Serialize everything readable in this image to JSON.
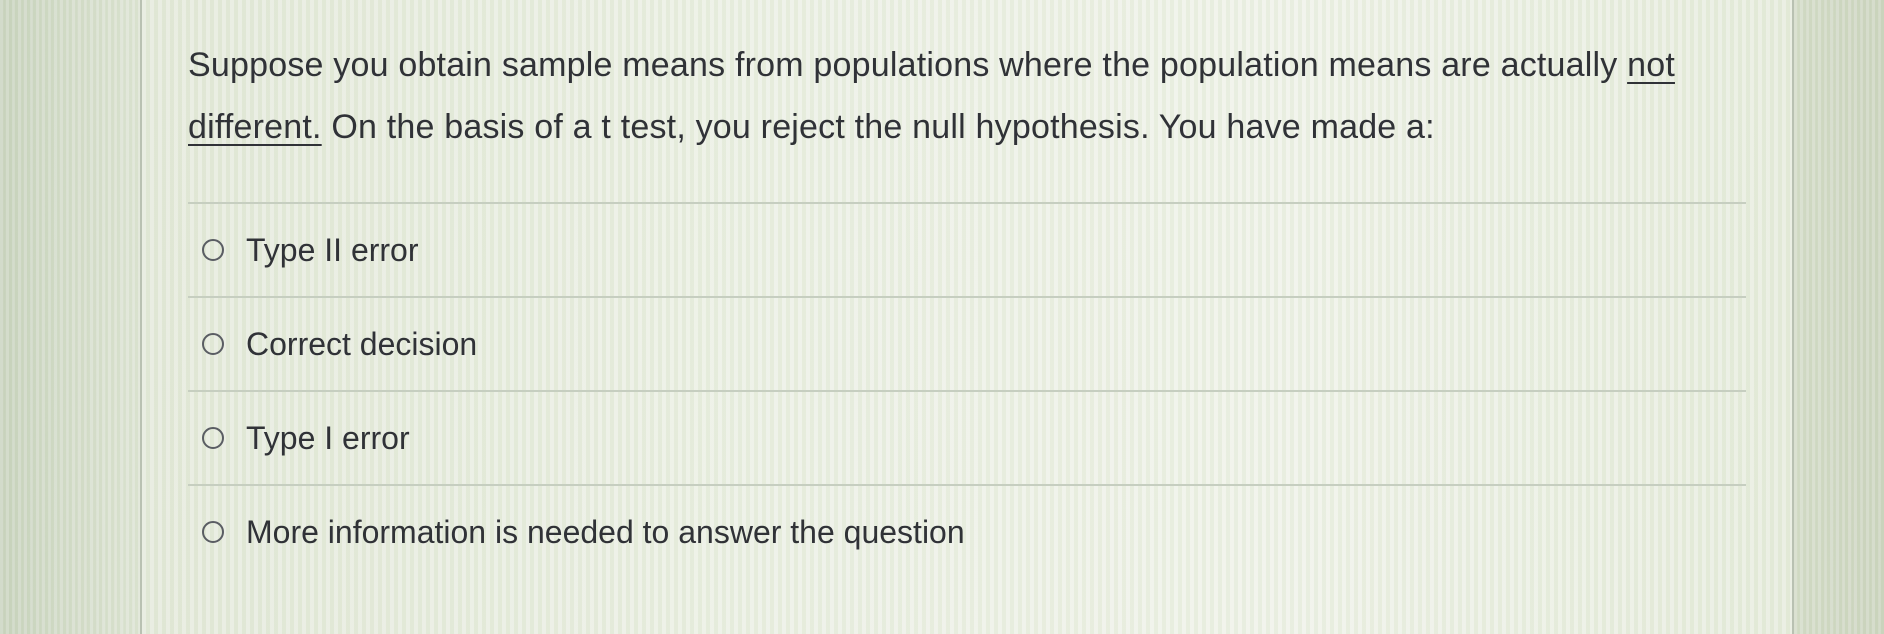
{
  "question": {
    "text_part1": "Suppose you obtain sample means from populations where the population means are actually ",
    "emphasis": "not different.",
    "text_part2": " On the basis of a t test, you reject the null hypothesis. You have made a:"
  },
  "answers": [
    {
      "label": "Type II error",
      "selected": false
    },
    {
      "label": "Correct decision",
      "selected": false
    },
    {
      "label": "Type I error",
      "selected": false
    },
    {
      "label": "More information is needed to answer the question",
      "selected": false
    }
  ],
  "icons": {
    "radio": "radio-button-unselected-icon"
  }
}
